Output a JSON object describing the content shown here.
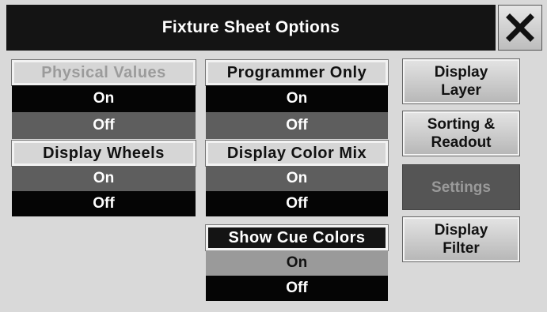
{
  "title": "Fixture Sheet Options",
  "close_icon": "close-icon",
  "groups": {
    "physical_values": {
      "label": "Physical Values",
      "on": "On",
      "off": "Off"
    },
    "programmer_only": {
      "label": "Programmer Only",
      "on": "On",
      "off": "Off"
    },
    "display_wheels": {
      "label": "Display Wheels",
      "on": "On",
      "off": "Off"
    },
    "display_color_mix": {
      "label": "Display Color Mix",
      "on": "On",
      "off": "Off"
    },
    "show_cue_colors": {
      "label": "Show Cue Colors",
      "on": "On",
      "off": "Off"
    }
  },
  "side": {
    "display_layer": "Display\nLayer",
    "sorting_readout": "Sorting &\nReadout",
    "settings": "Settings",
    "display_filter": "Display\nFilter"
  },
  "colors": {
    "title_bg": "#141414",
    "selected_black": "#050505",
    "unselected_gray": "#5e5e5e",
    "active_tab": "#555555"
  }
}
